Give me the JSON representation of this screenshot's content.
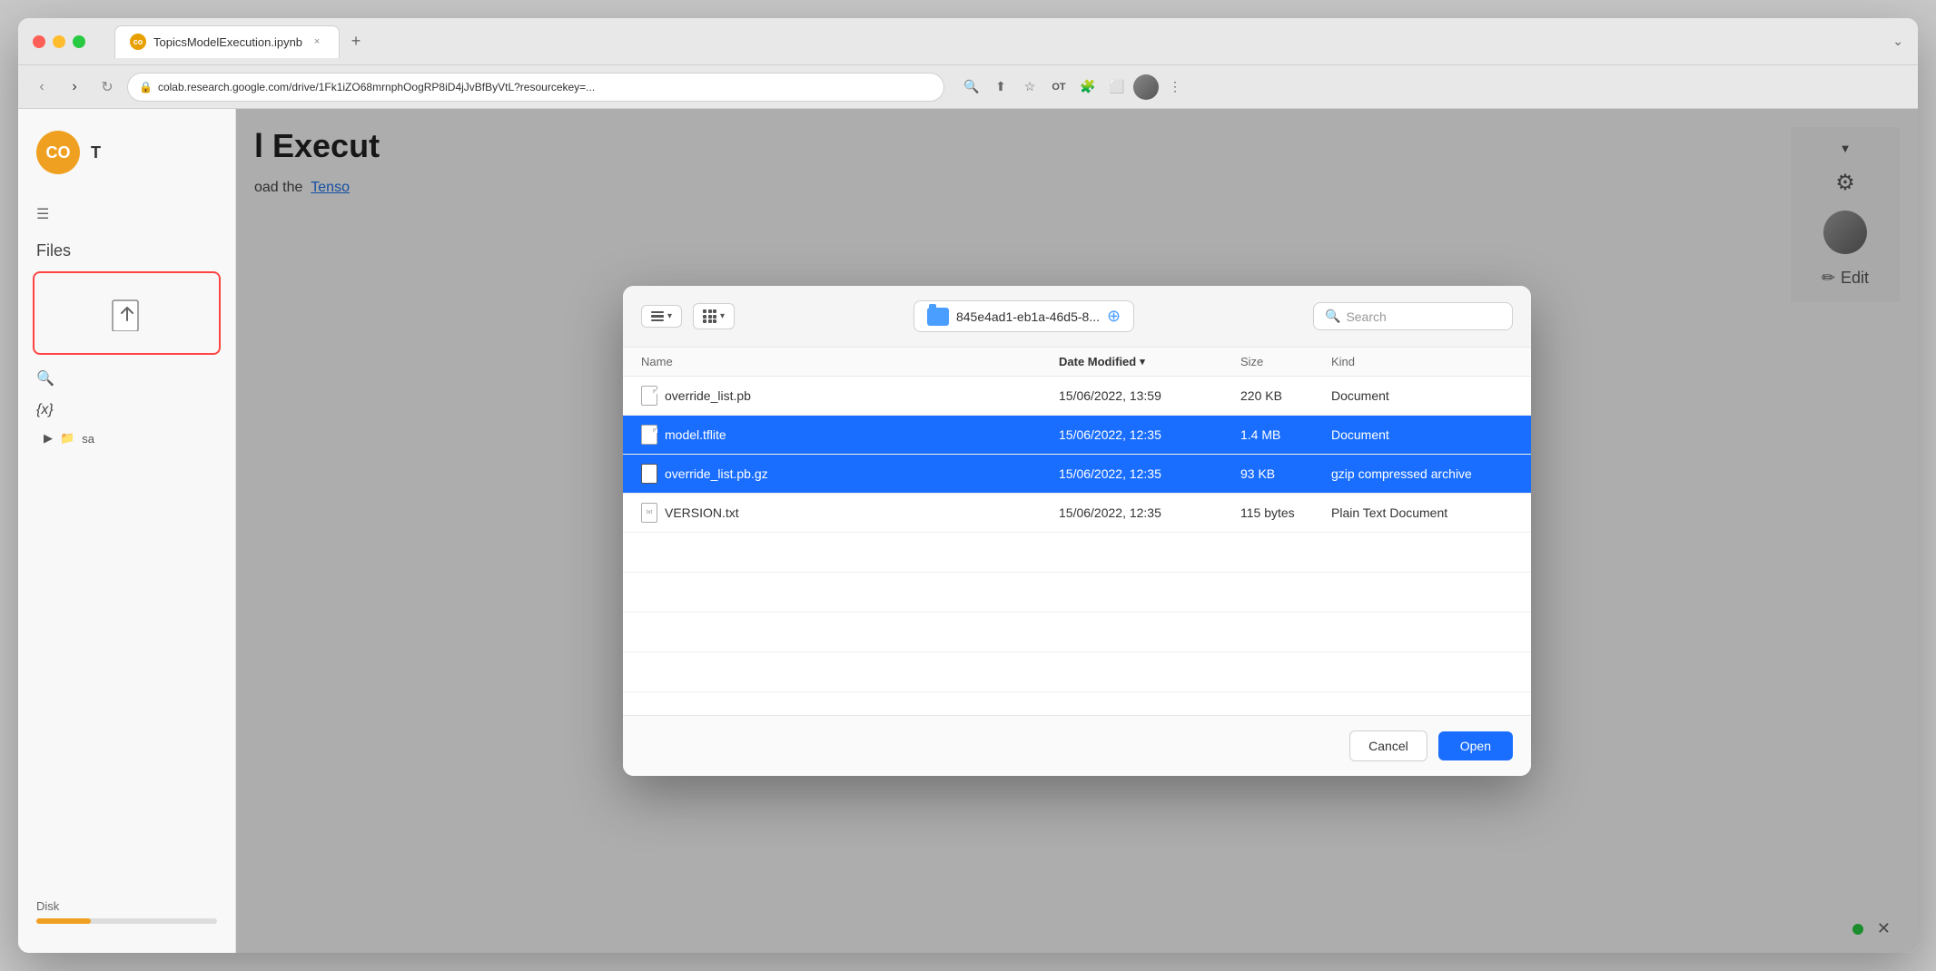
{
  "browser": {
    "tab_label": "TopicsModelExecution.ipynb",
    "tab_close": "×",
    "tab_add": "+",
    "url": "colab.research.google.com/drive/1Fk1iZO68mrnphOogRP8iD4jJvBfByVtL?resourcekey=...",
    "chevron_down": "⌄"
  },
  "sidebar": {
    "logo_text": "CO",
    "title": "T",
    "files_label": "Files",
    "search_icon_label": "🔍",
    "var_label": "{x}",
    "disk_label": "Disk",
    "folder_label": "sa"
  },
  "main": {
    "title_partial": "l Execut",
    "text_partial": "oad the",
    "link_partial": "Tenso"
  },
  "modal": {
    "folder_path": "845e4ad1-eb1a-46d5-8...",
    "search_placeholder": "Search",
    "columns": {
      "name": "Name",
      "date_modified": "Date Modified",
      "size": "Size",
      "kind": "Kind"
    },
    "files": [
      {
        "name": "override_list.pb",
        "date_modified": "15/06/2022, 13:59",
        "size": "220 KB",
        "kind": "Document",
        "selected": false,
        "icon_type": "doc"
      },
      {
        "name": "model.tflite",
        "date_modified": "15/06/2022, 12:35",
        "size": "1.4 MB",
        "kind": "Document",
        "selected": true,
        "icon_type": "doc"
      },
      {
        "name": "override_list.pb.gz",
        "date_modified": "15/06/2022, 12:35",
        "size": "93 KB",
        "kind": "gzip compressed archive",
        "selected": true,
        "icon_type": "gz"
      },
      {
        "name": "VERSION.txt",
        "date_modified": "15/06/2022, 12:35",
        "size": "115 bytes",
        "kind": "Plain Text Document",
        "selected": false,
        "icon_type": "txt"
      }
    ],
    "empty_rows": 4,
    "cancel_label": "Cancel",
    "open_label": "Open"
  },
  "right_panel": {
    "edit_label": "Edit"
  }
}
